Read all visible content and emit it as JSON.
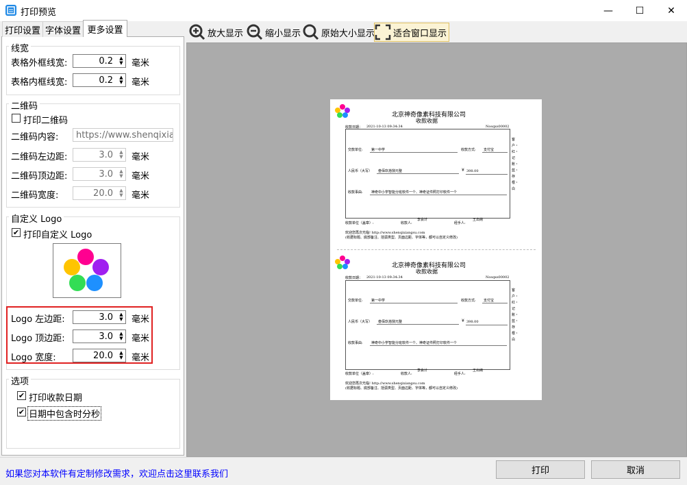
{
  "window": {
    "title": "打印预览",
    "minimize_glyph": "—",
    "maximize_glyph": "☐",
    "close_glyph": "✕"
  },
  "tabs": [
    "打印设置",
    "字体设置",
    "更多设置"
  ],
  "line_width": {
    "legend": "线宽",
    "outer_label": "表格外框线宽:",
    "outer_value": "0.2",
    "inner_label": "表格内框线宽:",
    "inner_value": "0.2",
    "unit": "毫米"
  },
  "qrcode": {
    "legend": "二维码",
    "print_label": "打印二维码",
    "print_checked": false,
    "content_label": "二维码内容:",
    "content_value": "https://www.shenqixiangsu",
    "left_label": "二维码左边距:",
    "left_value": "3.0",
    "top_label": "二维码顶边距:",
    "top_value": "3.0",
    "width_label": "二维码宽度:",
    "width_value": "20.0",
    "unit": "毫米"
  },
  "logo": {
    "legend": "自定义 Logo",
    "print_label": "打印自定义 Logo",
    "print_checked": true,
    "left_label": "Logo 左边距:",
    "left_value": "3.0",
    "top_label": "Logo 顶边距:",
    "top_value": "3.0",
    "width_label": "Logo 宽度:",
    "width_value": "20.0",
    "unit": "毫米",
    "highlight_color": "#e02020",
    "colors": [
      "#ff0090",
      "#a020f0",
      "#ffc400",
      "#33dd55",
      "#1e90ff"
    ]
  },
  "options": {
    "legend": "选项",
    "print_date_label": "打印收款日期",
    "print_date_checked": true,
    "date_time_label": "日期中包含时分秒",
    "date_time_checked": true
  },
  "toolbar": {
    "zoom_in": "放大显示",
    "zoom_out": "缩小显示",
    "original": "原始大小显示",
    "fit": "适合窗口显示"
  },
  "receipt": {
    "company": "北京神奇像素科技有限公司",
    "subtitle": "收款收据",
    "date_label": "收款日期：",
    "date_value": "2021-10-13 09:34:34",
    "number": "Nosqxs00002",
    "payer_label": "交款单位:",
    "payer_value": "第一中学",
    "method_label": "收款方式:",
    "method_value": "支付宝",
    "rmb_label": "人民币（大写）",
    "rmb_value": "叁佰玖拾捌元整",
    "yen_symbol": "¥",
    "amount": "398.00",
    "reason_label": "收款事由:",
    "reason_value": "神奇中小学智能分班软件一个、神奇证件照打印软件一个",
    "side_text": "客户・红・记账・蓝・存根・白",
    "accountant": "李会计",
    "director": "王出纳",
    "unit_seal": "收款单位（盖章）:",
    "receiver": "收款人:",
    "handler": "经手人:",
    "footer1": "欢迎您再次光临! http://www.shenqixiangsu.com",
    "footer2": "(收据标题、底部备注、括弧类型、页面边距、字体等，都可以自定义修改)"
  },
  "bottom": {
    "contact_text": "如果您对本软件有定制修改需求，欢迎点击这里联系我们",
    "print_button": "打印",
    "cancel_button": "取消"
  }
}
